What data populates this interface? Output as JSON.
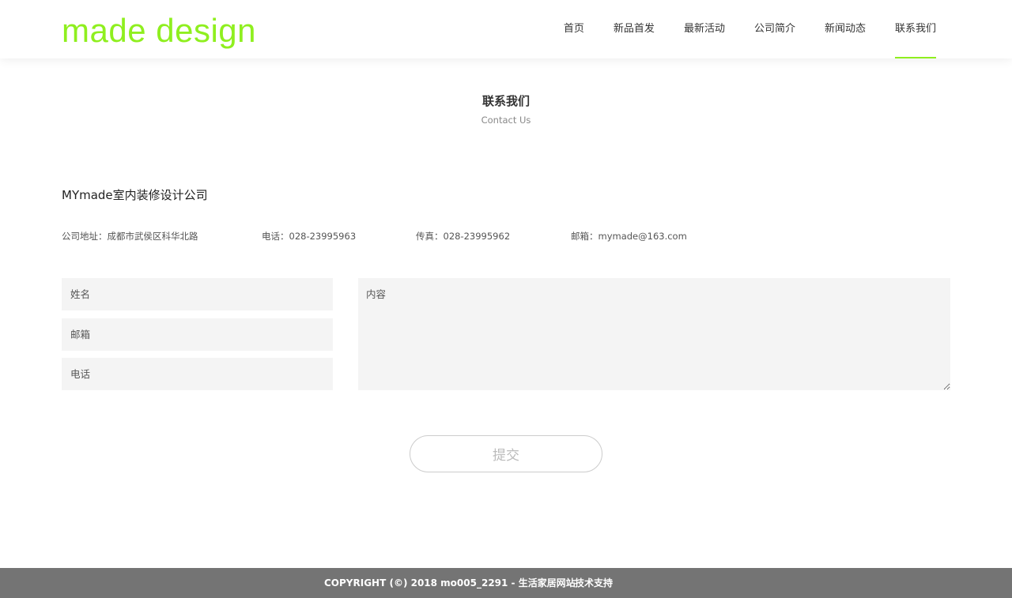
{
  "header": {
    "logo": "made design",
    "nav": [
      {
        "label": "首页",
        "active": false
      },
      {
        "label": "新品首发",
        "active": false
      },
      {
        "label": "最新活动",
        "active": false
      },
      {
        "label": "公司简介",
        "active": false
      },
      {
        "label": "新闻动态",
        "active": false
      },
      {
        "label": "联系我们",
        "active": true
      }
    ]
  },
  "section": {
    "title": "联系我们",
    "subtitle": "Contact Us"
  },
  "company": {
    "name": "MYmade室内装修设计公司",
    "address": "公司地址：成都市武侯区科华北路",
    "phone": "电话：028-23995963",
    "fax": "传真：028-23995962",
    "email": "邮箱：mymade@163.com"
  },
  "form": {
    "name_placeholder": "姓名",
    "email_placeholder": "邮箱",
    "phone_placeholder": "电话",
    "content_placeholder": "内容",
    "submit_label": "提交"
  },
  "footer": {
    "copyright": "COPYRIGHT (©) 2018 mo005_2291 - 生活家居网站",
    "support": "技术支持"
  },
  "colors": {
    "accent": "#8fef1f",
    "field_bg": "#f4f4f4",
    "footer_bg": "#747474"
  }
}
